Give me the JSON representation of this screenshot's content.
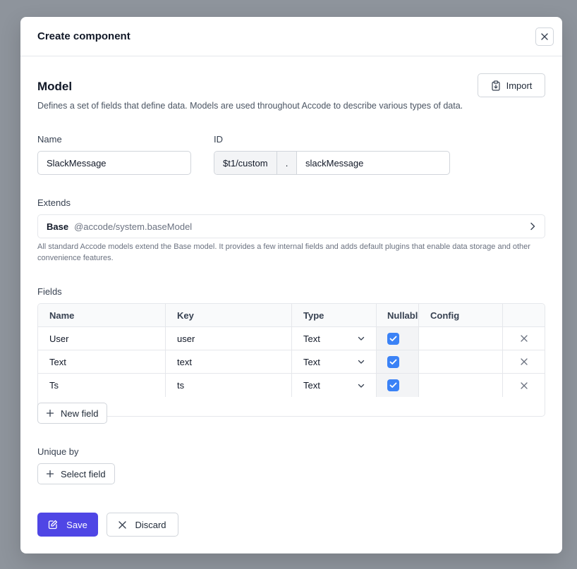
{
  "modal": {
    "title": "Create component"
  },
  "model": {
    "title": "Model",
    "description": "Defines a set of fields that define data. Models are used throughout Accode to describe various types of data.",
    "import_label": "Import"
  },
  "name_field": {
    "label": "Name",
    "value": "SlackMessage"
  },
  "id_field": {
    "label": "ID",
    "prefix": "$t1/custom",
    "separator": ".",
    "value": "slackMessage"
  },
  "extends": {
    "label": "Extends",
    "name": "Base",
    "path": "@accode/system.baseModel",
    "note": "All standard Accode models extend the Base model. It provides a few internal fields and adds default plugins that enable data storage and other convenience features."
  },
  "fields": {
    "label": "Fields",
    "columns": [
      "Name",
      "Key",
      "Type",
      "Nullable",
      "Config"
    ],
    "rows": [
      {
        "name": "User",
        "key": "user",
        "type": "Text",
        "nullable": true
      },
      {
        "name": "Text",
        "key": "text",
        "type": "Text",
        "nullable": true
      },
      {
        "name": "Ts",
        "key": "ts",
        "type": "Text",
        "nullable": true
      }
    ],
    "new_field_label": "New field"
  },
  "unique_by": {
    "label": "Unique by",
    "select_label": "Select field"
  },
  "actions": {
    "save_label": "Save",
    "discard_label": "Discard"
  },
  "colors": {
    "primary": "#4f46e5",
    "checkbox": "#3b82f6",
    "backdrop": "#8e949c"
  }
}
